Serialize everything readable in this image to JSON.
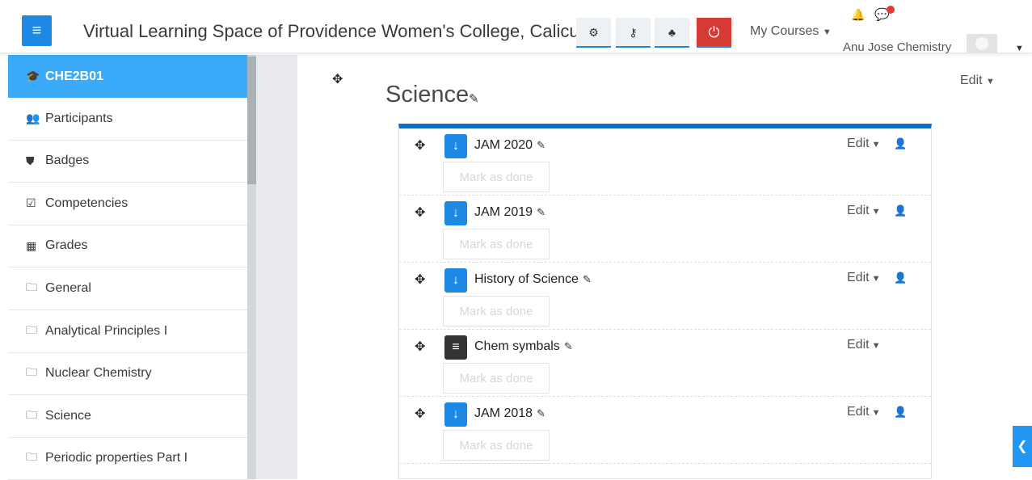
{
  "header": {
    "site_title": "Virtual Learning Space of Providence Women's College, Calicut",
    "menu_toggle_icon": "hamburger-icon",
    "tools": [
      {
        "icon": "cogs-icon",
        "glyph": "⚙"
      },
      {
        "icon": "key-icon",
        "glyph": "⚷"
      },
      {
        "icon": "sitemap-icon",
        "glyph": "♣"
      },
      {
        "icon": "power-icon",
        "glyph": "⏻"
      }
    ],
    "my_courses_label": "My Courses",
    "username": "Anu Jose Chemistry",
    "colors": {
      "accent": "#1e88e5",
      "power": "#d63a35"
    }
  },
  "sidebar": {
    "items": [
      {
        "label": "CHE2B01",
        "icon": "graduation-cap-icon",
        "glyph": "🎓"
      },
      {
        "label": "Participants",
        "icon": "users-icon",
        "glyph": "👥"
      },
      {
        "label": "Badges",
        "icon": "shield-icon",
        "glyph": "⛊"
      },
      {
        "label": "Competencies",
        "icon": "check-square-icon",
        "glyph": "☑"
      },
      {
        "label": "Grades",
        "icon": "table-icon",
        "glyph": "▦"
      },
      {
        "label": "General",
        "icon": "folder-icon",
        "glyph": "🗀"
      },
      {
        "label": "Analytical Principles I",
        "icon": "folder-icon",
        "glyph": "🗀"
      },
      {
        "label": "Nuclear Chemistry",
        "icon": "folder-icon",
        "glyph": "🗀"
      },
      {
        "label": "Science",
        "icon": "folder-icon",
        "glyph": "🗀"
      },
      {
        "label": "Periodic properties Part I",
        "icon": "folder-icon",
        "glyph": "🗀"
      }
    ]
  },
  "main": {
    "section_title": "Science",
    "section_edit_label": "Edit",
    "activities": [
      {
        "name": "JAM 2020",
        "type": "assignment",
        "edit_label": "Edit",
        "mark_label": "Mark as done",
        "has_person": true
      },
      {
        "name": "JAM 2019",
        "type": "assignment",
        "edit_label": "Edit",
        "mark_label": "Mark as done",
        "has_person": true
      },
      {
        "name": "History of Science",
        "type": "assignment",
        "edit_label": "Edit",
        "mark_label": "Mark as done",
        "has_person": true
      },
      {
        "name": "Chem symbals",
        "type": "file",
        "edit_label": "Edit",
        "mark_label": "Mark as done",
        "has_person": false
      },
      {
        "name": "JAM 2018",
        "type": "assignment",
        "edit_label": "Edit",
        "mark_label": "Mark as done",
        "has_person": true
      }
    ]
  }
}
